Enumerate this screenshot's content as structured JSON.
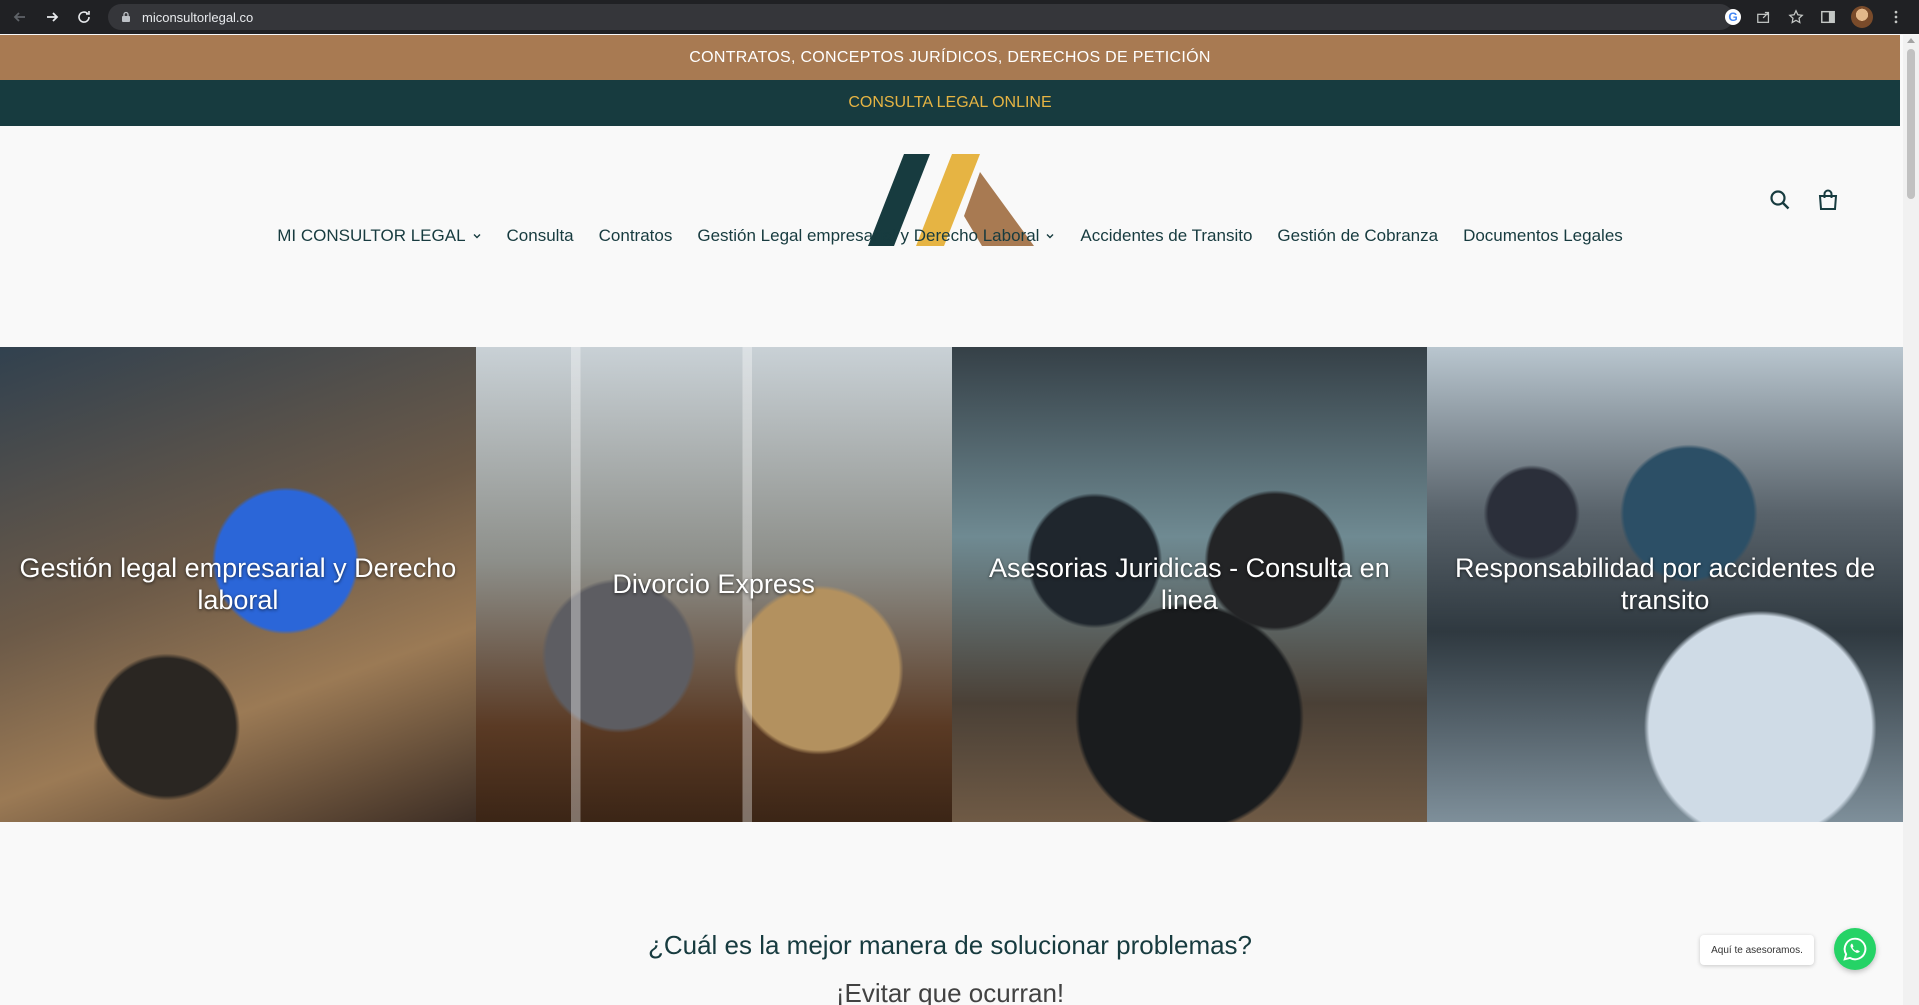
{
  "browser": {
    "url": "miconsultorlegal.co",
    "icons": [
      "back-arrow-icon",
      "forward-arrow-icon",
      "reload-icon",
      "lock-icon",
      "google-icon",
      "share-icon",
      "star-icon",
      "side-panel-icon",
      "profile-avatar",
      "kebab-menu-icon"
    ]
  },
  "announcements": {
    "top": "CONTRATOS, CONCEPTOS JURÍDICOS, DERECHOS DE PETICIÓN",
    "bottom": "CONSULTA LEGAL ONLINE"
  },
  "colors": {
    "brand_brown": "#a87a52",
    "brand_dark": "#173b3f",
    "brand_gold": "#e6b443",
    "whatsapp": "#25d366"
  },
  "header": {
    "icons": [
      "search-icon",
      "shopping-bag-icon"
    ]
  },
  "nav": {
    "items": [
      {
        "label": "MI CONSULTOR LEGAL",
        "has_dropdown": true
      },
      {
        "label": "Consulta",
        "has_dropdown": false
      },
      {
        "label": "Contratos",
        "has_dropdown": false
      },
      {
        "label": "Gestión Legal empresarial y Derecho Laboral",
        "has_dropdown": true
      },
      {
        "label": "Accidentes de Transito",
        "has_dropdown": false
      },
      {
        "label": "Gestión de Cobranza",
        "has_dropdown": false
      },
      {
        "label": "Documentos Legales",
        "has_dropdown": false
      }
    ]
  },
  "collections": [
    {
      "title": "Gestión legal empresarial y Derecho laboral"
    },
    {
      "title": "Divorcio Express"
    },
    {
      "title": "Asesorias Juridicas - Consulta en linea"
    },
    {
      "title": "Responsabilidad por accidentes de transito"
    }
  ],
  "section": {
    "headline": "¿Cuál es la mejor manera de solucionar problemas?",
    "subheadline": "¡Evitar que ocurran!"
  },
  "whatsapp": {
    "bubble": "Aquí te asesoramos.",
    "icon": "whatsapp-icon"
  }
}
